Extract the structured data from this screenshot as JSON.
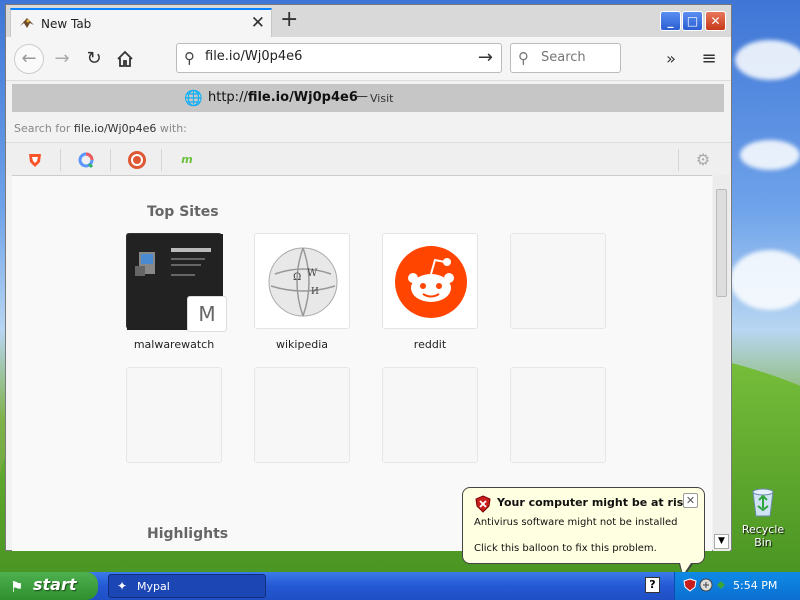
{
  "browser": {
    "tab_title": "New Tab",
    "url_value": "file.io/Wj0p4e6",
    "search_placeholder": "Search",
    "suggestion": {
      "prefix": "http://",
      "host": "file.io/Wj0p4e6",
      "dash": "—",
      "action": "Visit"
    },
    "search_with": {
      "prefix": "Search for ",
      "query": "file.io/Wj0p4e6",
      "suffix": " with:"
    }
  },
  "newtab": {
    "top_sites_title": "Top Sites",
    "highlights_title": "Highlights",
    "sites": [
      {
        "label": "malwarewatch",
        "letter": "M"
      },
      {
        "label": "wikipedia"
      },
      {
        "label": "reddit"
      }
    ]
  },
  "balloon": {
    "title": "Your computer might be at risk",
    "line1": "Antivirus software might not be installed",
    "line2": "Click this balloon to fix this problem."
  },
  "desktop": {
    "recycle_bin_label": "Recycle Bin"
  },
  "taskbar": {
    "start_label": "start",
    "task_label": "Mypal",
    "clock": "5:54 PM",
    "help_glyph": "?"
  },
  "colors": {
    "tab_accent": "#0a84ff",
    "reddit": "#ff4500",
    "balloon_bg": "#ffffe1",
    "taskbar": "#245edb",
    "start": "#3c9e3c"
  }
}
